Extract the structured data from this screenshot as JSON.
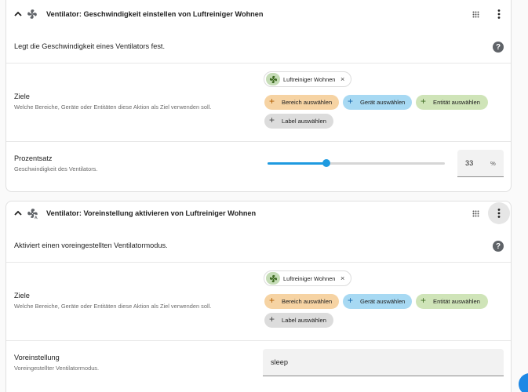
{
  "actions": [
    {
      "title": "Ventilator: Geschwindigkeit einstellen von Luftreiniger Wohnen",
      "service_icon": "fan-icon",
      "description": "Legt die Geschwindigkeit eines Ventilators fest.",
      "targets": {
        "label": "Ziele",
        "sublabel": "Welche Bereiche, Geräte oder Entitäten diese Aktion als Ziel verwenden soll.",
        "selected_entity": "Luftreiniger Wohnen",
        "add_area": "Bereich auswählen",
        "add_device": "Gerät auswählen",
        "add_entity": "Entität auswählen",
        "add_label": "Label auswählen"
      },
      "field": {
        "label": "Prozentsatz",
        "sublabel": "Geschwindigkeit des Ventilators.",
        "value": "33",
        "unit": "%",
        "slider_fraction": 0.33
      }
    },
    {
      "title": "Ventilator: Voreinstellung aktivieren von Luftreiniger Wohnen",
      "service_icon": "fan-auto-icon",
      "description": "Aktiviert einen voreingestellten Ventilatormodus.",
      "targets": {
        "label": "Ziele",
        "sublabel": "Welche Bereiche, Geräte oder Entitäten diese Aktion als Ziel verwenden soll.",
        "selected_entity": "Luftreiniger Wohnen",
        "add_area": "Bereich auswählen",
        "add_device": "Gerät auswählen",
        "add_entity": "Entität auswählen",
        "add_label": "Label auswählen"
      },
      "field": {
        "label": "Voreinstellung",
        "sublabel": "Voreingestellter Ventilatormodus.",
        "value": "sleep"
      }
    }
  ],
  "colors": {
    "accent": "#1e9ae0",
    "area_chip": "#f6d3a3",
    "device_chip": "#a7d9f3",
    "entity_chip": "#cfe4b8",
    "label_chip": "#dcdcdc"
  }
}
